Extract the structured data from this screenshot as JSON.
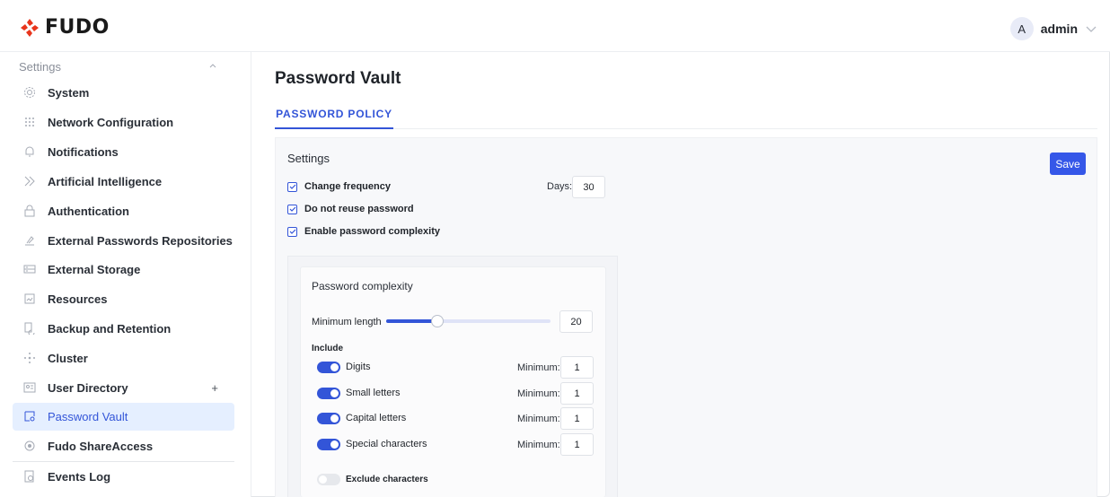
{
  "header": {
    "brand": "FUDO",
    "user_initial": "A",
    "user_name": "admin"
  },
  "sidebar": {
    "section_title": "Settings",
    "items": [
      {
        "label": "System",
        "icon": "gear-icon"
      },
      {
        "label": "Network Configuration",
        "icon": "network-icon"
      },
      {
        "label": "Notifications",
        "icon": "bell-icon"
      },
      {
        "label": "Artificial Intelligence",
        "icon": "ai-icon"
      },
      {
        "label": "Authentication",
        "icon": "lock-icon"
      },
      {
        "label": "External Passwords Repositories",
        "icon": "key-icon"
      },
      {
        "label": "External Storage",
        "icon": "storage-icon"
      },
      {
        "label": "Resources",
        "icon": "resources-icon"
      },
      {
        "label": "Backup and Retention",
        "icon": "backup-icon"
      },
      {
        "label": "Cluster",
        "icon": "cluster-icon"
      },
      {
        "label": "User Directory",
        "icon": "user-directory-icon",
        "extra": "+"
      },
      {
        "label": "Password Vault",
        "icon": "vault-icon",
        "active": true
      },
      {
        "label": "Fudo ShareAccess",
        "icon": "share-icon"
      },
      {
        "label": "Events Log",
        "icon": "events-log-icon"
      }
    ]
  },
  "main": {
    "title": "Password Vault",
    "tab": "PASSWORD POLICY",
    "settings_title": "Settings",
    "save_label": "Save",
    "change_frequency": "Change frequency",
    "days_label": "Days:",
    "days_value": "30",
    "no_reuse": "Do not reuse password",
    "complexity_enabled": "Enable password complexity",
    "complexity": {
      "title": "Password complexity",
      "min_length_label": "Minimum length",
      "min_length_value": "20",
      "slider_fraction": 0.31,
      "include_label": "Include",
      "minimum_label": "Minimum:",
      "rules": [
        {
          "label": "Digits",
          "min": "1",
          "on": true
        },
        {
          "label": "Small letters",
          "min": "1",
          "on": true
        },
        {
          "label": "Capital letters",
          "min": "1",
          "on": true
        },
        {
          "label": "Special characters",
          "min": "1",
          "on": true
        }
      ],
      "exclude_label": "Exclude characters",
      "exclude_on": false
    }
  },
  "colors": {
    "accent": "#3355d8",
    "brand_red": "#e8351c",
    "active_bg": "#e5efff"
  }
}
